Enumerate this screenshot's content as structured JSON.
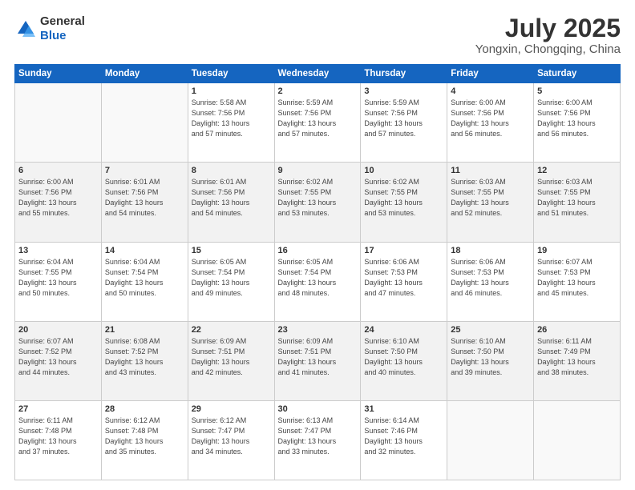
{
  "header": {
    "logo_line1": "General",
    "logo_line2": "Blue",
    "month": "July 2025",
    "location": "Yongxin, Chongqing, China"
  },
  "weekdays": [
    "Sunday",
    "Monday",
    "Tuesday",
    "Wednesday",
    "Thursday",
    "Friday",
    "Saturday"
  ],
  "weeks": [
    {
      "shaded": false,
      "days": [
        {
          "num": "",
          "info": ""
        },
        {
          "num": "",
          "info": ""
        },
        {
          "num": "1",
          "info": "Sunrise: 5:58 AM\nSunset: 7:56 PM\nDaylight: 13 hours\nand 57 minutes."
        },
        {
          "num": "2",
          "info": "Sunrise: 5:59 AM\nSunset: 7:56 PM\nDaylight: 13 hours\nand 57 minutes."
        },
        {
          "num": "3",
          "info": "Sunrise: 5:59 AM\nSunset: 7:56 PM\nDaylight: 13 hours\nand 57 minutes."
        },
        {
          "num": "4",
          "info": "Sunrise: 6:00 AM\nSunset: 7:56 PM\nDaylight: 13 hours\nand 56 minutes."
        },
        {
          "num": "5",
          "info": "Sunrise: 6:00 AM\nSunset: 7:56 PM\nDaylight: 13 hours\nand 56 minutes."
        }
      ]
    },
    {
      "shaded": true,
      "days": [
        {
          "num": "6",
          "info": "Sunrise: 6:00 AM\nSunset: 7:56 PM\nDaylight: 13 hours\nand 55 minutes."
        },
        {
          "num": "7",
          "info": "Sunrise: 6:01 AM\nSunset: 7:56 PM\nDaylight: 13 hours\nand 54 minutes."
        },
        {
          "num": "8",
          "info": "Sunrise: 6:01 AM\nSunset: 7:56 PM\nDaylight: 13 hours\nand 54 minutes."
        },
        {
          "num": "9",
          "info": "Sunrise: 6:02 AM\nSunset: 7:55 PM\nDaylight: 13 hours\nand 53 minutes."
        },
        {
          "num": "10",
          "info": "Sunrise: 6:02 AM\nSunset: 7:55 PM\nDaylight: 13 hours\nand 53 minutes."
        },
        {
          "num": "11",
          "info": "Sunrise: 6:03 AM\nSunset: 7:55 PM\nDaylight: 13 hours\nand 52 minutes."
        },
        {
          "num": "12",
          "info": "Sunrise: 6:03 AM\nSunset: 7:55 PM\nDaylight: 13 hours\nand 51 minutes."
        }
      ]
    },
    {
      "shaded": false,
      "days": [
        {
          "num": "13",
          "info": "Sunrise: 6:04 AM\nSunset: 7:55 PM\nDaylight: 13 hours\nand 50 minutes."
        },
        {
          "num": "14",
          "info": "Sunrise: 6:04 AM\nSunset: 7:54 PM\nDaylight: 13 hours\nand 50 minutes."
        },
        {
          "num": "15",
          "info": "Sunrise: 6:05 AM\nSunset: 7:54 PM\nDaylight: 13 hours\nand 49 minutes."
        },
        {
          "num": "16",
          "info": "Sunrise: 6:05 AM\nSunset: 7:54 PM\nDaylight: 13 hours\nand 48 minutes."
        },
        {
          "num": "17",
          "info": "Sunrise: 6:06 AM\nSunset: 7:53 PM\nDaylight: 13 hours\nand 47 minutes."
        },
        {
          "num": "18",
          "info": "Sunrise: 6:06 AM\nSunset: 7:53 PM\nDaylight: 13 hours\nand 46 minutes."
        },
        {
          "num": "19",
          "info": "Sunrise: 6:07 AM\nSunset: 7:53 PM\nDaylight: 13 hours\nand 45 minutes."
        }
      ]
    },
    {
      "shaded": true,
      "days": [
        {
          "num": "20",
          "info": "Sunrise: 6:07 AM\nSunset: 7:52 PM\nDaylight: 13 hours\nand 44 minutes."
        },
        {
          "num": "21",
          "info": "Sunrise: 6:08 AM\nSunset: 7:52 PM\nDaylight: 13 hours\nand 43 minutes."
        },
        {
          "num": "22",
          "info": "Sunrise: 6:09 AM\nSunset: 7:51 PM\nDaylight: 13 hours\nand 42 minutes."
        },
        {
          "num": "23",
          "info": "Sunrise: 6:09 AM\nSunset: 7:51 PM\nDaylight: 13 hours\nand 41 minutes."
        },
        {
          "num": "24",
          "info": "Sunrise: 6:10 AM\nSunset: 7:50 PM\nDaylight: 13 hours\nand 40 minutes."
        },
        {
          "num": "25",
          "info": "Sunrise: 6:10 AM\nSunset: 7:50 PM\nDaylight: 13 hours\nand 39 minutes."
        },
        {
          "num": "26",
          "info": "Sunrise: 6:11 AM\nSunset: 7:49 PM\nDaylight: 13 hours\nand 38 minutes."
        }
      ]
    },
    {
      "shaded": false,
      "days": [
        {
          "num": "27",
          "info": "Sunrise: 6:11 AM\nSunset: 7:48 PM\nDaylight: 13 hours\nand 37 minutes."
        },
        {
          "num": "28",
          "info": "Sunrise: 6:12 AM\nSunset: 7:48 PM\nDaylight: 13 hours\nand 35 minutes."
        },
        {
          "num": "29",
          "info": "Sunrise: 6:12 AM\nSunset: 7:47 PM\nDaylight: 13 hours\nand 34 minutes."
        },
        {
          "num": "30",
          "info": "Sunrise: 6:13 AM\nSunset: 7:47 PM\nDaylight: 13 hours\nand 33 minutes."
        },
        {
          "num": "31",
          "info": "Sunrise: 6:14 AM\nSunset: 7:46 PM\nDaylight: 13 hours\nand 32 minutes."
        },
        {
          "num": "",
          "info": ""
        },
        {
          "num": "",
          "info": ""
        }
      ]
    }
  ]
}
